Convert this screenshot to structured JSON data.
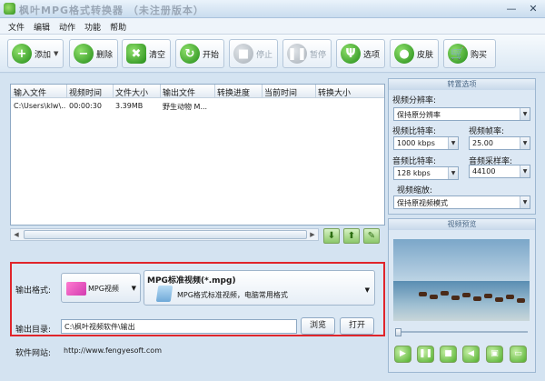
{
  "window": {
    "title": "枫叶MPG格式转换器 （未注册版本）",
    "minimize": "—",
    "close": "✕"
  },
  "menu": [
    "文件",
    "编辑",
    "动作",
    "功能",
    "帮助"
  ],
  "toolbar": {
    "add": "添加",
    "delete": "删除",
    "clear": "清空",
    "start": "开始",
    "stop": "停止",
    "pause": "暂停",
    "options": "选项",
    "skin": "皮肤",
    "buy": "购买"
  },
  "file_list": {
    "columns": [
      "输入文件",
      "视频时间",
      "文件大小",
      "输出文件",
      "转换进度",
      "当前时间",
      "转换大小"
    ],
    "rows": [
      [
        "C:\\Users\\klw\\...",
        "00:00:30",
        "3.39MB",
        "野生动物 M...",
        "",
        "",
        ""
      ]
    ]
  },
  "output": {
    "format_label": "输出格式:",
    "format_category": "MPG视频",
    "format_name": "MPG标准视频(*.mpg)",
    "format_desc": "MPG格式标准视频，电脑常用格式",
    "dir_label": "输出目录:",
    "dir_value": "C:\\枫叶视频软件\\输出",
    "browse": "浏览",
    "open": "打开",
    "site_label": "软件网站:",
    "site_url": "http://www.fengyesoft.com"
  },
  "settings": {
    "title": "转置选项",
    "resolution_label": "视频分辨率:",
    "resolution_value": "保持原分辨率",
    "vbitrate_label": "视频比特率:",
    "vbitrate_value": "1000 kbps",
    "framerate_label": "视频帧率:",
    "framerate_value": "25.00",
    "abitrate_label": "音频比特率:",
    "abitrate_value": "128 kbps",
    "samplerate_label": "音频采样率:",
    "samplerate_value": "44100",
    "scale_label": "视频缩放:",
    "scale_value": "保持原视频模式"
  },
  "preview": {
    "title": "视频预览"
  }
}
